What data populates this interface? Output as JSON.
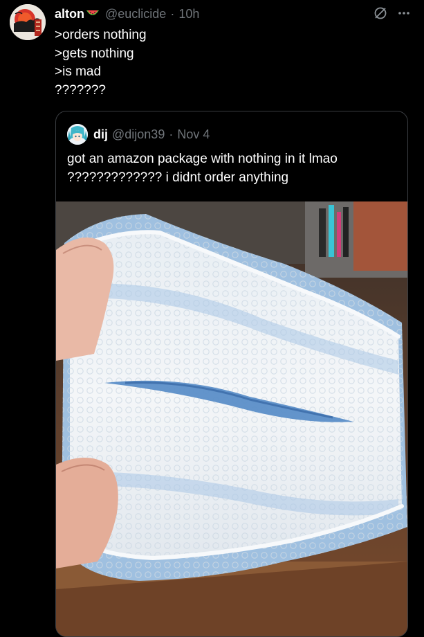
{
  "tweet": {
    "author": {
      "display_name": "alton",
      "emoji": "watermelon-icon",
      "handle": "@euclicide",
      "separator": "·",
      "time": "10h"
    },
    "lines": [
      ">orders nothing",
      ">gets nothing",
      ">is mad",
      "???????"
    ],
    "actions": {
      "icons": [
        "grok-icon",
        "more-icon"
      ]
    }
  },
  "quote": {
    "author": {
      "display_name": "dij",
      "handle": "@dijon39",
      "separator": "·",
      "date": "Nov 4"
    },
    "lines": [
      "got an amazon package with nothing in it lmao",
      "????????????? i didnt order anything"
    ],
    "media": {
      "type": "photo",
      "description_icon": "empty-bubble-mailer-photo"
    }
  },
  "colors": {
    "background": "#000000",
    "text_primary": "#ffffff",
    "text_secondary": "#71767b",
    "border": "#3a3d41",
    "mailer_blue": "#8fb3d9"
  }
}
